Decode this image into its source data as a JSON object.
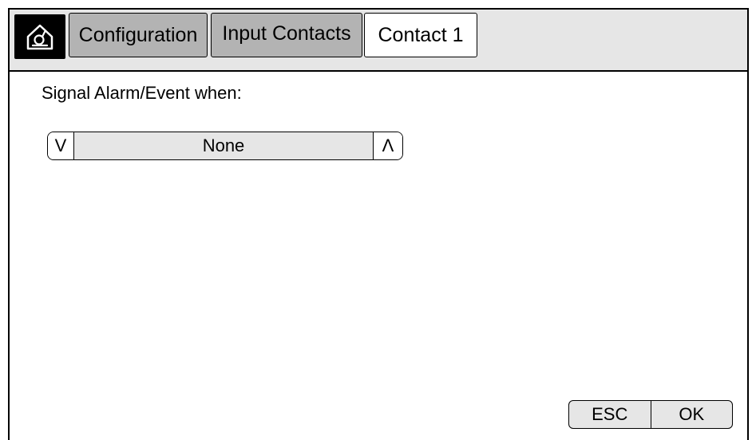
{
  "header": {
    "home_icon": "home-icon",
    "tabs": [
      {
        "label": "Configuration",
        "state": "inactive"
      },
      {
        "label": "Input Contacts",
        "state": "inactive"
      },
      {
        "label": "Contact 1",
        "state": "active"
      }
    ]
  },
  "main": {
    "prompt": "Signal Alarm/Event when:",
    "selector": {
      "down_label": "V",
      "value": "None",
      "up_label": "Λ"
    }
  },
  "footer": {
    "esc_label": "ESC",
    "ok_label": "OK"
  },
  "colors": {
    "header_bg": "#e6e6e6",
    "inactive_tab_bg": "#b3b3b3",
    "active_tab_bg": "#ffffff",
    "home_button_bg": "#000000"
  }
}
